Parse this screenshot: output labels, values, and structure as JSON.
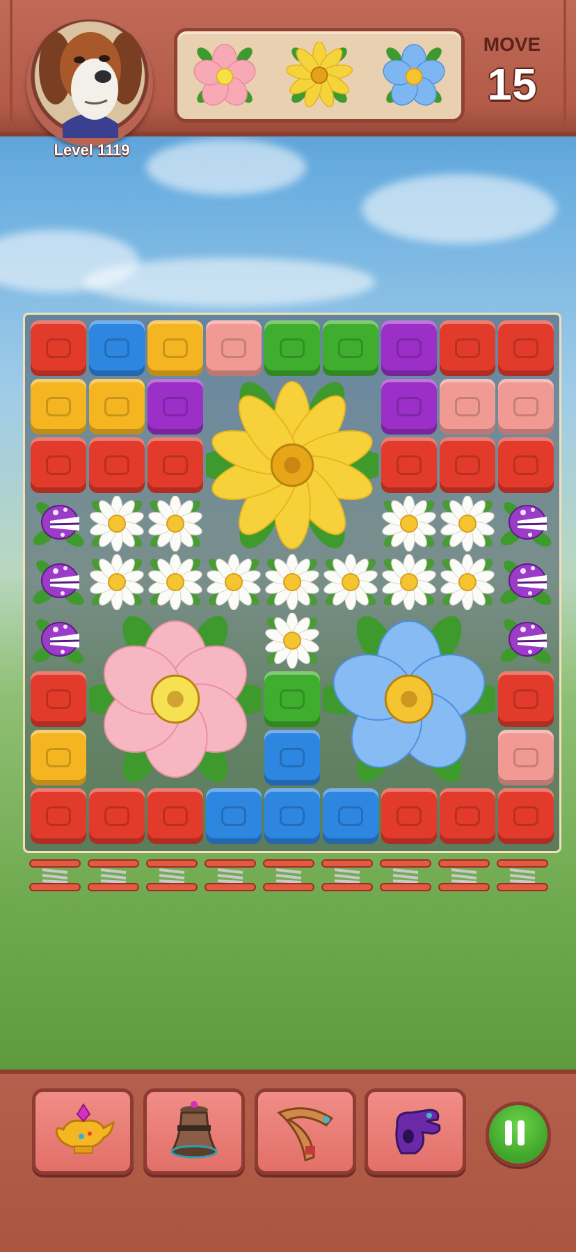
{
  "hud": {
    "level_label": "Level 1119",
    "move_label": "MOVE",
    "move_count": "15",
    "goals": [
      {
        "icon": "pink-flower-icon",
        "color": "#f7a9b6"
      },
      {
        "icon": "yellow-flower-icon",
        "color": "#f5d33a"
      },
      {
        "icon": "blue-flower-icon",
        "color": "#7eb6f2"
      }
    ]
  },
  "colors": {
    "red": "#e23b2b",
    "blue": "#2d86e0",
    "yellow": "#f5b521",
    "pink": "#f19a94",
    "green": "#3fae2e",
    "purple": "#9b2fc8"
  },
  "board": {
    "columns": 9,
    "rows": 9,
    "grid": [
      [
        "red",
        "blue",
        "yellow",
        "pink",
        "green",
        "green",
        "purple",
        "red",
        "red"
      ],
      [
        "yellow",
        "yellow",
        "purple",
        "big-yellow",
        "big-yellow",
        "big-yellow",
        "purple",
        "pink",
        "pink"
      ],
      [
        "red",
        "red",
        "red",
        "big-yellow",
        "big-yellow",
        "big-yellow",
        "red",
        "red",
        "red"
      ],
      [
        "chomper",
        "daisy",
        "daisy",
        "big-yellow",
        "big-yellow",
        "big-yellow",
        "daisy",
        "daisy",
        "chomper"
      ],
      [
        "chomper",
        "daisy",
        "daisy",
        "daisy",
        "daisy",
        "daisy",
        "daisy",
        "daisy",
        "chomper"
      ],
      [
        "chomper",
        "big-pink",
        "big-pink",
        "big-pink",
        "daisy",
        "big-blue",
        "big-blue",
        "big-blue",
        "chomper"
      ],
      [
        "red",
        "big-pink",
        "big-pink",
        "big-pink",
        "green",
        "big-blue",
        "big-blue",
        "big-blue",
        "red"
      ],
      [
        "yellow",
        "big-pink",
        "big-pink",
        "big-pink",
        "blue",
        "big-blue",
        "big-blue",
        "big-blue",
        "pink"
      ],
      [
        "red",
        "red",
        "red",
        "blue",
        "blue",
        "blue",
        "red",
        "red",
        "red"
      ]
    ]
  },
  "springs_count": 9,
  "boosters": [
    {
      "name": "magic-lamp",
      "icon": "magic-lamp-icon"
    },
    {
      "name": "bell",
      "icon": "bell-icon"
    },
    {
      "name": "boomerang",
      "icon": "boomerang-icon"
    },
    {
      "name": "glove",
      "icon": "glove-icon"
    }
  ],
  "pause": {
    "icon": "pause-icon"
  }
}
